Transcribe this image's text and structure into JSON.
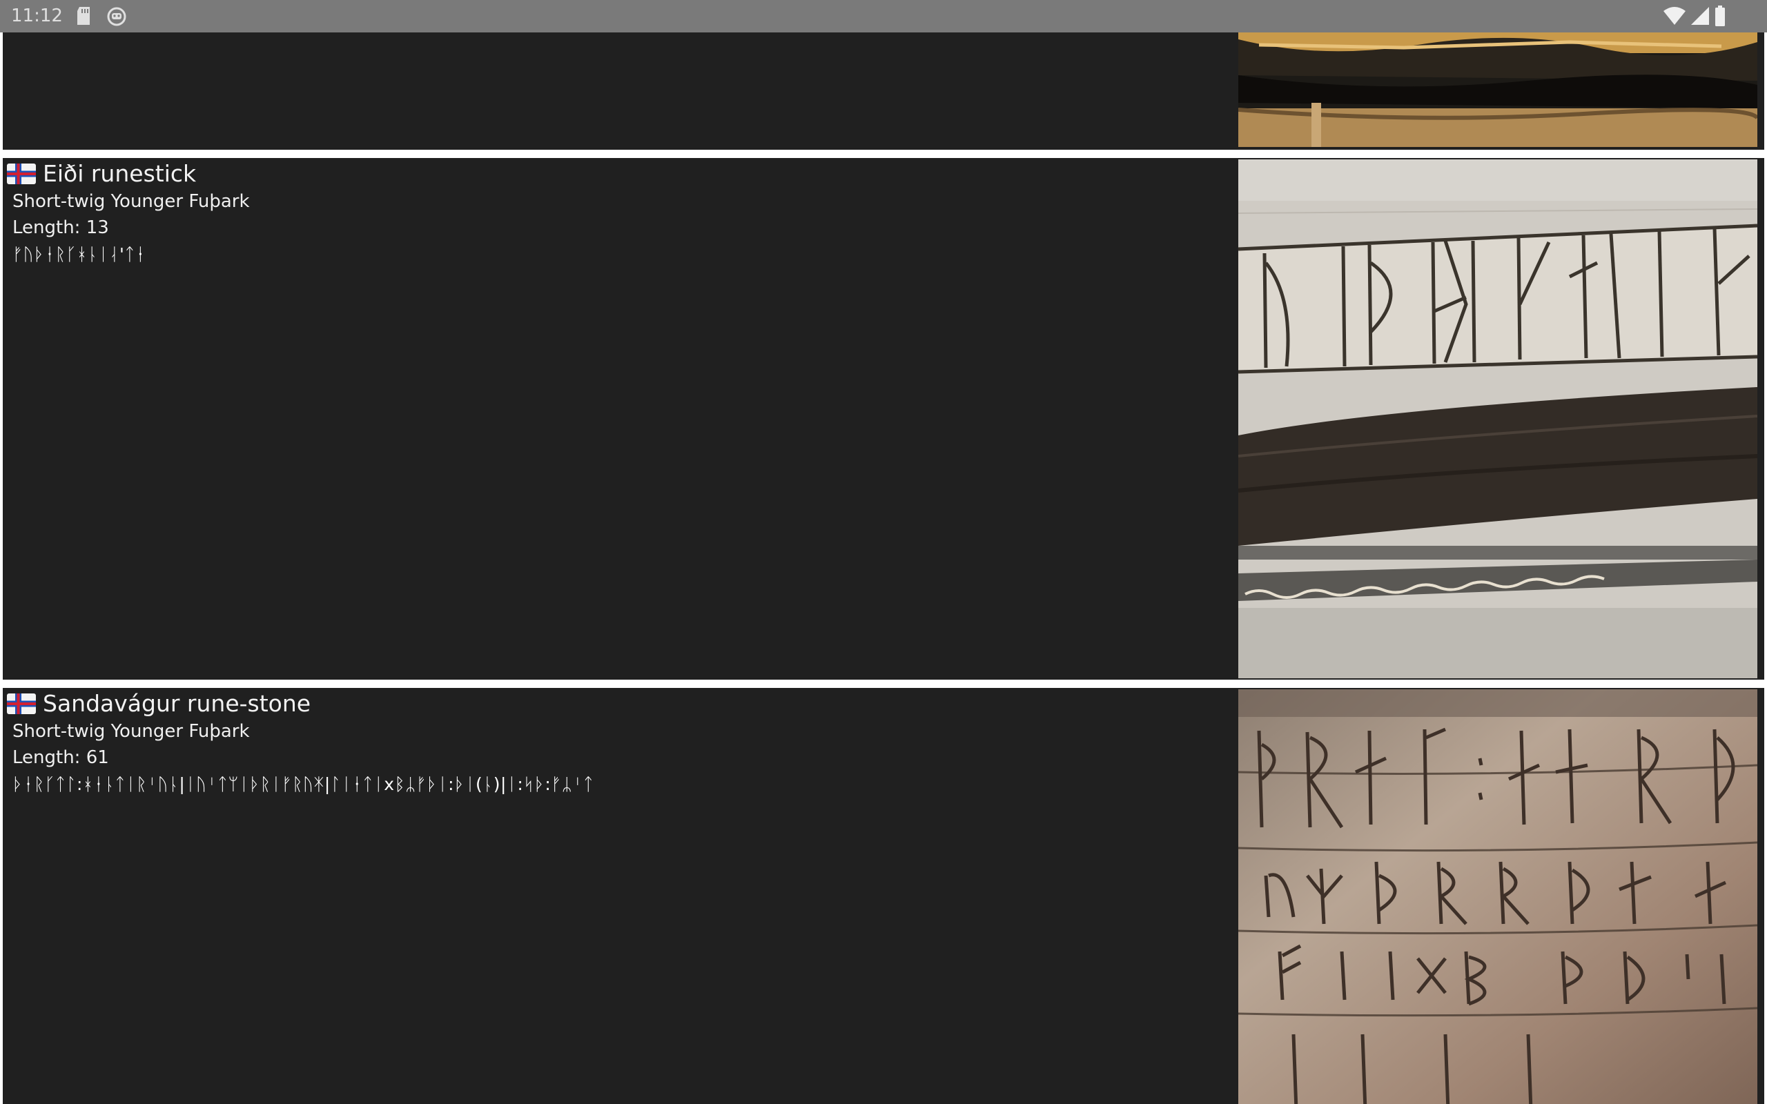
{
  "status_bar": {
    "time": "11:12",
    "icons": [
      "sd-card-icon",
      "android-bot-icon",
      "wifi-icon",
      "signal-icon",
      "battery-icon"
    ]
  },
  "cards": [
    {
      "flag": "faroe-islands-flag-icon",
      "title": "Eiði runestick",
      "script": "Short-twig Younger Fuþark",
      "length": "Length: 13",
      "runes": "ᚠᚢᚦᚽᚱᚴᚼᚿᛁᛆ'ᛏᚽ",
      "photo": "eidi-runestick-photo"
    },
    {
      "flag": "faroe-islands-flag-icon",
      "title": "Sandavágur rune-stone",
      "script": "Short-twig Younger Fuþark",
      "length": "Length: 61",
      "runes": "ᚦᚽᚱᚴᛏᛚ:ᚼᚽᚿᛏᛁᚱᛌᚢᚿ|ᛁᚢᛌᛏᛘᛁᚦᚱᛁᚠᚱᚢᛡ|ᛚᛁᚽᛏᛁxᛒᛦᚠᚦᛁ:ᚦᛁ(ᚿ)|ᛁ:ᛋᚦ:ᚠᛦᛌᛏ",
      "photo": "sandavagur-runestone-photo"
    }
  ],
  "colors": {
    "status_bar_bg": "#7a7a7a",
    "card_bg": "#202020",
    "separator": "#ffffff",
    "text": "#f2f2f2"
  }
}
